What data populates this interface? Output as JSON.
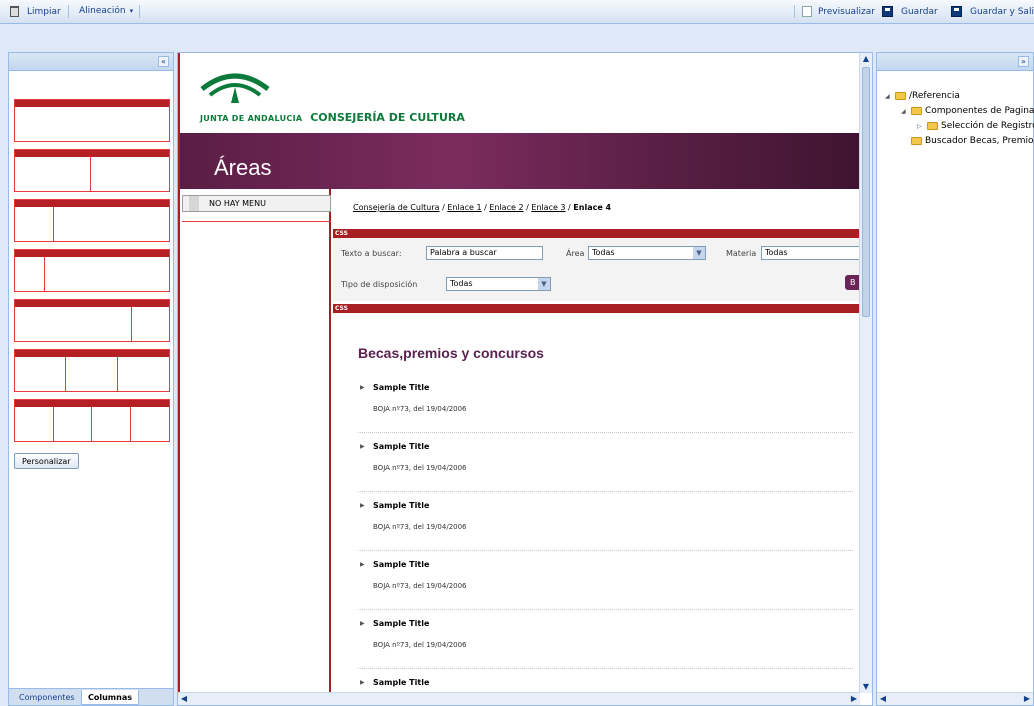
{
  "toolbar": {
    "limpiar": "Limpiar",
    "alineacion": "Alineación",
    "previsualizar": "Previsualizar",
    "guardar": "Guardar",
    "guardar_salir": "Guardar y Salir"
  },
  "left_panel": {
    "collapse": "«",
    "personalizar": "Personalizar",
    "tabs": [
      "Componentes",
      "Columnas"
    ],
    "active_tab": "Columnas"
  },
  "site": {
    "logo_small": "JUNTA DE ANDALUCIA",
    "logo_main": "CONSEJERÍA DE CULTURA",
    "banner_title": "Áreas",
    "menu_empty": "NO HAY MENU",
    "breadcrumb": {
      "links": [
        "Consejería de Cultura",
        "Enlace 1",
        "Enlace 2",
        "Enlace 3"
      ],
      "current": "Enlace 4"
    },
    "css_tag": "CSS",
    "search": {
      "texto_label": "Texto a buscar:",
      "texto_value": "Palabra a buscar",
      "area_label": "Área",
      "area_value": "Todas",
      "materia_label": "Materia",
      "materia_value": "Todas",
      "tipo_label": "Tipo de disposición",
      "tipo_value": "Todas",
      "buscar_label": "B"
    },
    "section_title": "Becas,premios y concursos",
    "results": [
      {
        "title": "Sample Title",
        "sub": "BOJA nº73, del 19/04/2006"
      },
      {
        "title": "Sample Title",
        "sub": "BOJA nº73, del 19/04/2006"
      },
      {
        "title": "Sample Title",
        "sub": "BOJA nº73, del 19/04/2006"
      },
      {
        "title": "Sample Title",
        "sub": "BOJA nº73, del 19/04/2006"
      },
      {
        "title": "Sample Title",
        "sub": "BOJA nº73, del 19/04/2006"
      },
      {
        "title": "Sample Title",
        "sub": ""
      }
    ]
  },
  "right_panel": {
    "expand": "»",
    "tree": [
      {
        "label": "/Referencia"
      },
      {
        "label": "Componentes de Pagina"
      },
      {
        "label": "Selección de Registro"
      },
      {
        "label": "Buscador Becas, Premio"
      }
    ]
  },
  "colors": {
    "accent_red": "#a71f23",
    "banner_purple": "#6b2457",
    "ext_blue": "#99bbe8"
  }
}
